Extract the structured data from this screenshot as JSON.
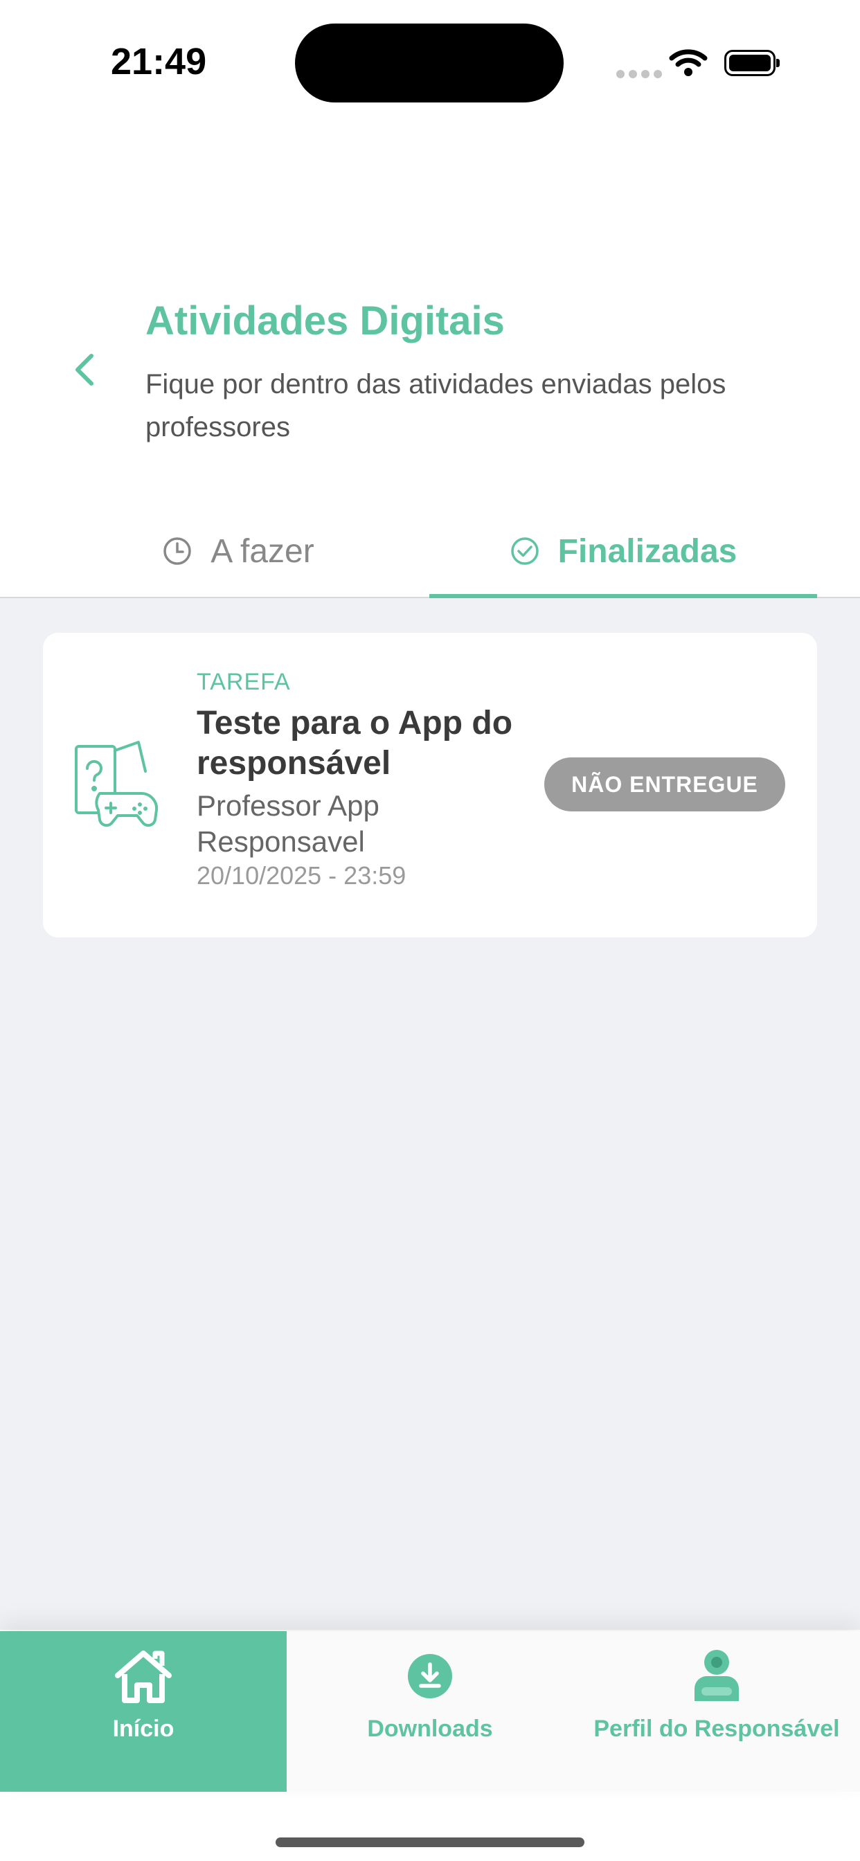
{
  "status_bar": {
    "time": "21:49"
  },
  "header": {
    "title": "Atividades Digitais",
    "subtitle": "Fique por dentro das atividades enviadas pelos professores"
  },
  "tabs": [
    {
      "label": "A fazer",
      "icon": "clock-icon",
      "active": false
    },
    {
      "label": "Finalizadas",
      "icon": "check-circle-icon",
      "active": true
    }
  ],
  "activities": [
    {
      "type": "TAREFA",
      "title": "Teste para o App do responsável",
      "teacher": "Professor App Responsavel",
      "due": "20/10/2025 - 23:59",
      "status": "NÃO ENTREGUE",
      "icon": "game-quiz-icon"
    }
  ],
  "bottom_nav": [
    {
      "label": "Início",
      "icon": "home-icon",
      "active": true
    },
    {
      "label": "Downloads",
      "icon": "download-icon",
      "active": false
    },
    {
      "label": "Perfil do Responsável",
      "icon": "profile-icon",
      "active": false
    }
  ],
  "colors": {
    "accent": "#5dc3a1",
    "background": "#eff1f5",
    "badge": "#9d9d9d"
  }
}
